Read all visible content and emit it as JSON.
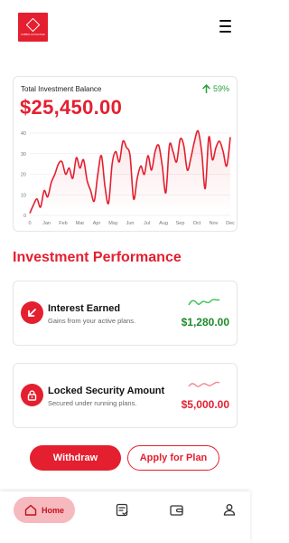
{
  "app": {
    "logo_text": "SABBAL EXCHANGE"
  },
  "balance": {
    "label": "Total Investment Balance",
    "value": "$25,450.00",
    "change": "59%"
  },
  "chart_data": {
    "type": "line",
    "categories": [
      "0",
      "Jan",
      "Feb",
      "Mar",
      "Apr",
      "May",
      "Jun",
      "Jul",
      "Aug",
      "Sep",
      "Oct",
      "Nov",
      "Dec"
    ],
    "yticks": [
      0,
      10,
      20,
      30,
      40
    ],
    "ylim": [
      0,
      40
    ],
    "grid": true,
    "series": [
      {
        "values": [
          1,
          5,
          8,
          4,
          12,
          9,
          16,
          20,
          25,
          26,
          20,
          23,
          18,
          28,
          23,
          27,
          17,
          12,
          7,
          20,
          29,
          14,
          6,
          25,
          31,
          26,
          36,
          33,
          29,
          8,
          18,
          24,
          20,
          29,
          22,
          31,
          34,
          24,
          11,
          34,
          31,
          26,
          37,
          34,
          22,
          28,
          36,
          41,
          31,
          13,
          38,
          27,
          33,
          36,
          31,
          24,
          38
        ]
      }
    ],
    "color": "#e41f2f"
  },
  "section": {
    "title": "Investment Performance"
  },
  "interest": {
    "title": "Interest Earned",
    "subtitle": "Gains from your active plans.",
    "amount": "$1,280.00",
    "color": "#1f8a2c"
  },
  "locked": {
    "title": "Locked Security Amount",
    "subtitle": "Secured under running plans.",
    "amount": "$5,000.00",
    "color": "#e41f2f"
  },
  "actions": {
    "withdraw": "Withdraw",
    "apply": "Apply for Plan"
  },
  "nav": {
    "home": "Home"
  }
}
